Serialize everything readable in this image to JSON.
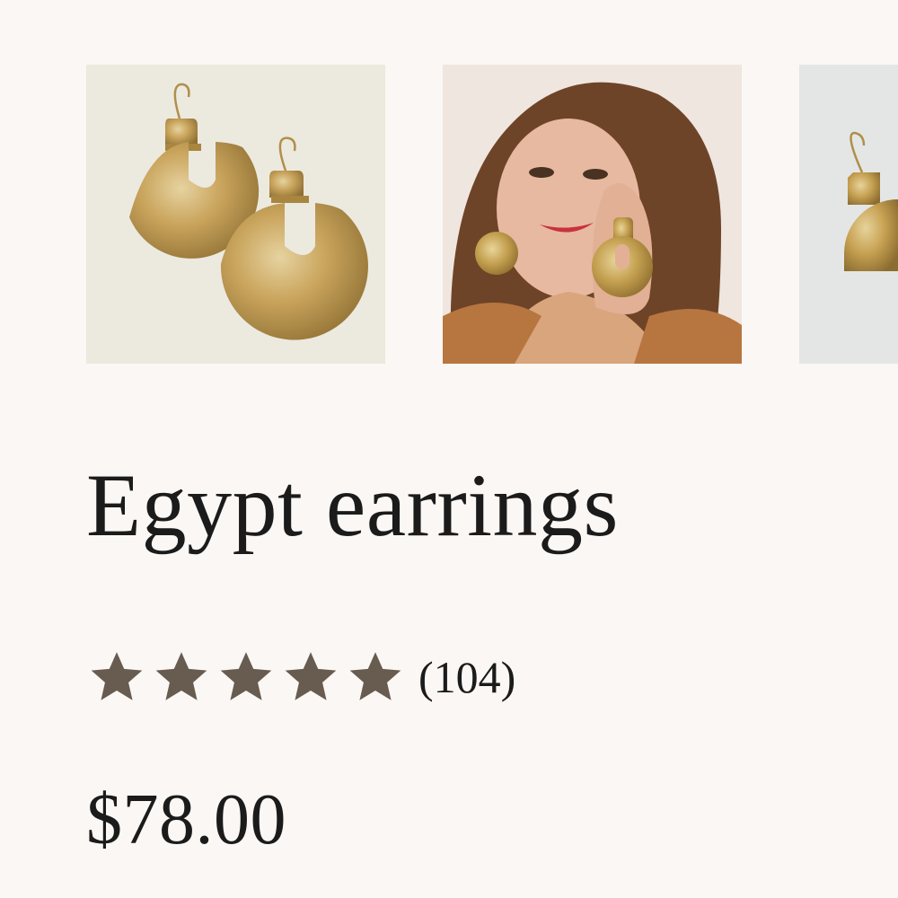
{
  "gallery": {
    "images": [
      {
        "icon": "gold-earrings-pair-image",
        "alt": "Egypt earrings pair on cream background"
      },
      {
        "icon": "model-wearing-earrings-image",
        "alt": "Woman wearing Egypt earrings"
      },
      {
        "icon": "earring-on-stone-image",
        "alt": "Egypt earring on grey stone"
      }
    ]
  },
  "product": {
    "title": "Egypt earrings",
    "rating": {
      "value": 5,
      "max": 5,
      "count_label": "(104)",
      "star_color": "#685b4f"
    },
    "price": "$78.00"
  },
  "colors": {
    "background": "#faf7f4",
    "text": "#1b1b1b",
    "gold": "#c9a45c"
  }
}
